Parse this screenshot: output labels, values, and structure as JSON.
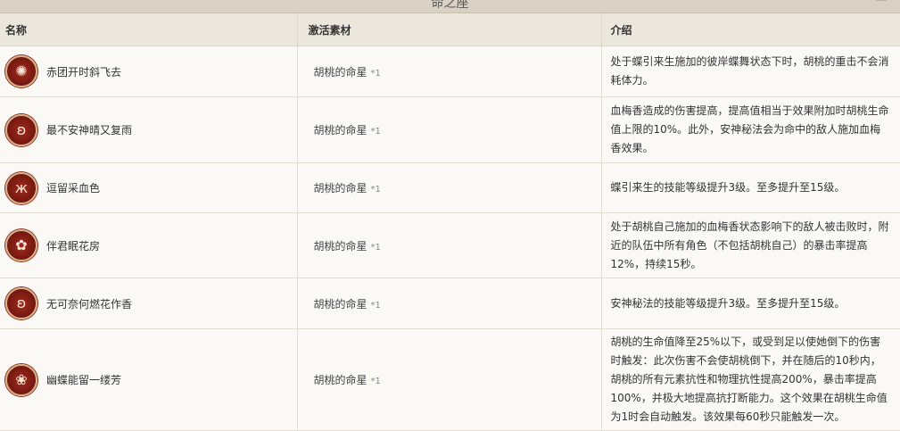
{
  "page": {
    "title": "命之座"
  },
  "table": {
    "headers": {
      "name": "名称",
      "material": "激活素材",
      "desc": "介绍"
    },
    "rows": [
      {
        "icon": "butterfly-swirl-icon",
        "name": "赤团开时斜飞去",
        "material": "胡桃的命星",
        "qty": "*1",
        "desc": "处于蝶引来生施加的彼岸蝶舞状态下时，胡桃的重击不会消耗体力。"
      },
      {
        "icon": "ghost-icon",
        "name": "最不安神晴又复雨",
        "material": "胡桃的命星",
        "qty": "*1",
        "desc": "血梅香造成的伤害提高，提高值相当于效果附加时胡桃生命值上限的10%。此外，安神秘法会为命中的敌人施加血梅香效果。"
      },
      {
        "icon": "butterfly-icon",
        "name": "逗留采血色",
        "material": "胡桃的命星",
        "qty": "*1",
        "desc": "蝶引来生的技能等级提升3级。至多提升至15级。"
      },
      {
        "icon": "plum-blossom-icon",
        "name": "伴君眠花房",
        "material": "胡桃的命星",
        "qty": "*1",
        "desc": "处于胡桃自己施加的血梅香状态影响下的敌人被击败时，附近的队伍中所有角色（不包括胡桃自己）的暴击率提高12%，持续15秒。"
      },
      {
        "icon": "ghost-icon",
        "name": "无可奈何燃花作香",
        "material": "胡桃的命星",
        "qty": "*1",
        "desc": "安神秘法的技能等级提升3级。至多提升至15级。"
      },
      {
        "icon": "flower-skull-icon",
        "name": "幽蝶能留一缕芳",
        "material": "胡桃的命星",
        "qty": "*1",
        "desc": "胡桃的生命值降至25%以下，或受到足以使她倒下的伤害时触发：此次伤害不会使胡桃倒下，并在随后的10秒内，胡桃的所有元素抗性和物理抗性提高200%，暴击率提高100%，并极大地提高抗打断能力。这个效果在胡桃生命值为1时会自动触发。该效果每60秒只能触发一次。"
      }
    ]
  }
}
